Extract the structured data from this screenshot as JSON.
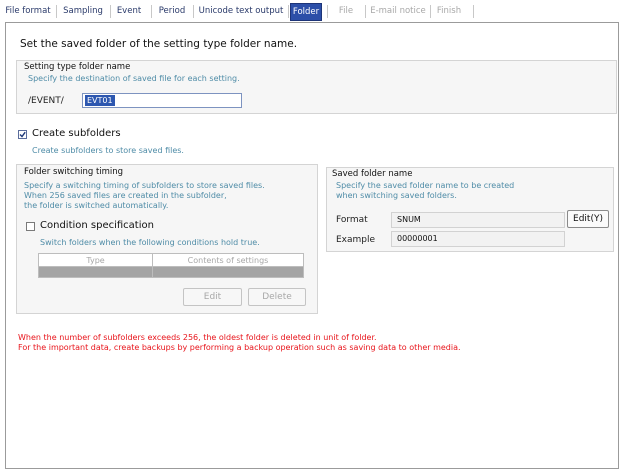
{
  "tabs": [
    {
      "label": "File format"
    },
    {
      "label": "Sampling"
    },
    {
      "label": "Event"
    },
    {
      "label": "Period"
    },
    {
      "label": "Unicode text output"
    },
    {
      "label": "Folder"
    },
    {
      "label": "File"
    },
    {
      "label": "E-mail notice"
    },
    {
      "label": "Finish"
    }
  ],
  "page": {
    "title": "Set the saved folder of the setting type folder name."
  },
  "setting_type": {
    "group_label": "Setting type folder name",
    "hint": "Specify the destination of saved file for each setting.",
    "prefix": "/EVENT/",
    "value": "EVT01"
  },
  "create_subfolders": {
    "checked": true,
    "label": "Create subfolders",
    "hint": "Create subfolders to store saved files."
  },
  "switching": {
    "group_label": "Folder switching timing",
    "hint_lines": [
      "Specify a switching timing of subfolders to store saved files.",
      "When 256 saved files are created in the subfolder,",
      "the folder is switched automatically."
    ],
    "condition_label": "Condition specification",
    "condition_checked": false,
    "condition_hint": "Switch folders when the following conditions hold true.",
    "table_headers": [
      "Type",
      "Contents of settings"
    ],
    "edit_label": "Edit",
    "delete_label": "Delete"
  },
  "saved_folder": {
    "group_label": "Saved folder name",
    "hint_lines": [
      "Specify the saved folder name to be created",
      "when switching saved folders."
    ],
    "format_label": "Format",
    "format_value": "SNUM",
    "edit_label": "Edit(Y)",
    "example_label": "Example",
    "example_value": "00000001"
  },
  "warnings": [
    "When the number of subfolders exceeds 256, the oldest folder is deleted in unit of folder.",
    "For the important data, create backups by performing a backup operation such as saving data to other media."
  ]
}
